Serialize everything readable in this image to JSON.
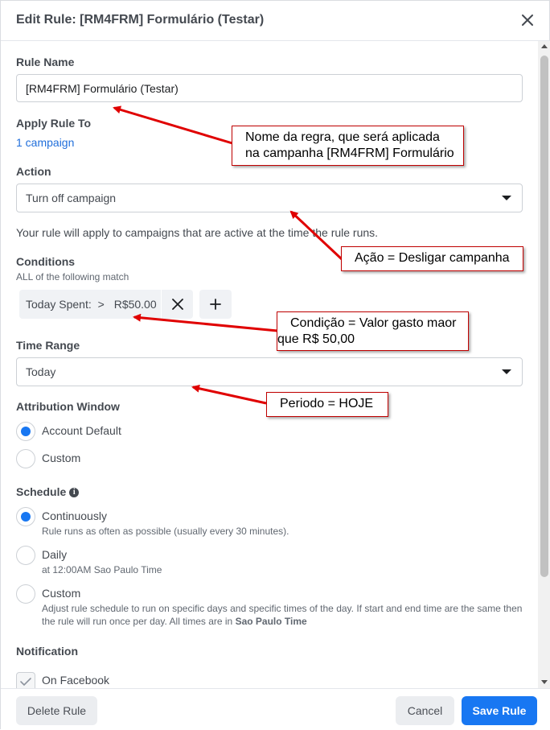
{
  "dialog": {
    "title": "Edit Rule: [RM4FRM] Formulário (Testar)",
    "close_icon": "close-icon"
  },
  "rule_name": {
    "label": "Rule Name",
    "value": "[RM4FRM] Formulário (Testar)"
  },
  "apply_rule_to": {
    "label": "Apply Rule To",
    "link": "1 campaign"
  },
  "action": {
    "label": "Action",
    "selected": "Turn off campaign",
    "help": "Your rule will apply to campaigns that are active at the time the rule runs."
  },
  "conditions": {
    "label": "Conditions",
    "sublabel": "ALL of the following match",
    "chip": {
      "metric": "Today Spent:",
      "operator": ">",
      "value": "R$50.00"
    },
    "remove_icon": "close-icon",
    "add_icon": "plus-icon"
  },
  "time_range": {
    "label": "Time Range",
    "selected": "Today"
  },
  "attribution_window": {
    "label": "Attribution Window",
    "options": [
      {
        "label": "Account Default",
        "selected": true
      },
      {
        "label": "Custom",
        "selected": false
      }
    ]
  },
  "schedule": {
    "label": "Schedule",
    "info_icon": "info-icon",
    "options": [
      {
        "label": "Continuously",
        "desc": "Rule runs as often as possible (usually every 30 minutes).",
        "selected": true
      },
      {
        "label": "Daily",
        "desc": "at 12:00AM Sao Paulo Time",
        "selected": false
      },
      {
        "label": "Custom",
        "desc_line1": "Adjust rule schedule to run on specific days and specific times of the day. If start and end time are the same then",
        "desc_line2_prefix": "the rule will run once per day. All times are in ",
        "desc_line2_bold": "Sao Paulo Time",
        "selected": false
      }
    ]
  },
  "notification": {
    "label": "Notification",
    "options": [
      {
        "label": "On Facebook",
        "checked": true
      }
    ]
  },
  "footer": {
    "delete_label": "Delete Rule",
    "cancel_label": "Cancel",
    "save_label": "Save Rule"
  },
  "annotations": [
    {
      "line1": "Nome da regra, que será aplicada",
      "line2": "na campanha [RM4FRM] Formulário"
    },
    {
      "line1": "Ação = Desligar campanha"
    },
    {
      "line1": "Condição = Valor gasto maor",
      "line2": "que R$ 50,00"
    },
    {
      "line1": "Periodo = HOJE"
    }
  ],
  "colors": {
    "accent": "#1877f2",
    "link": "#216fdb",
    "annotation_arrow": "#e00000",
    "annotation_border": "#c00000"
  }
}
